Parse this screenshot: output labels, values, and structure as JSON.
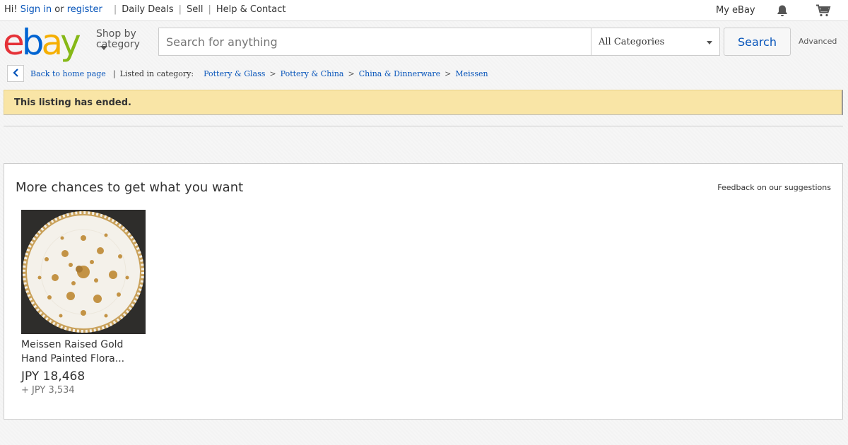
{
  "topbar": {
    "greeting": "Hi!",
    "sign_in": "Sign in",
    "or": "or",
    "register": "register",
    "links": [
      "Daily Deals",
      "Sell",
      "Help & Contact"
    ],
    "my_ebay": "My eBay"
  },
  "header": {
    "logo": [
      "e",
      "b",
      "a",
      "y"
    ],
    "shop_by_line1": "Shop by",
    "shop_by_line2": "category",
    "search_placeholder": "Search for anything",
    "category_selected": "All Categories",
    "search_button": "Search",
    "advanced": "Advanced"
  },
  "breadcrumb": {
    "back": "Back to home page",
    "listed_in": "Listed in category:",
    "categories": [
      "Pottery & Glass",
      "Pottery & China",
      "China & Dinnerware",
      "Meissen"
    ]
  },
  "banner": {
    "message": "This listing has ended."
  },
  "suggestions": {
    "title": "More chances to get what you want",
    "feedback": "Feedback on our suggestions",
    "items": [
      {
        "title_line1": "Meissen Raised Gold",
        "title_line2": "Hand Painted Flora...",
        "price": "JPY 18,468",
        "shipping": "+ JPY 3,534"
      }
    ]
  },
  "colors": {
    "link": "#0654ba",
    "banner": "#f9e5a6",
    "logo_e": "#e53238",
    "logo_b": "#0064d2",
    "logo_a": "#f5af02",
    "logo_y": "#86b817"
  }
}
